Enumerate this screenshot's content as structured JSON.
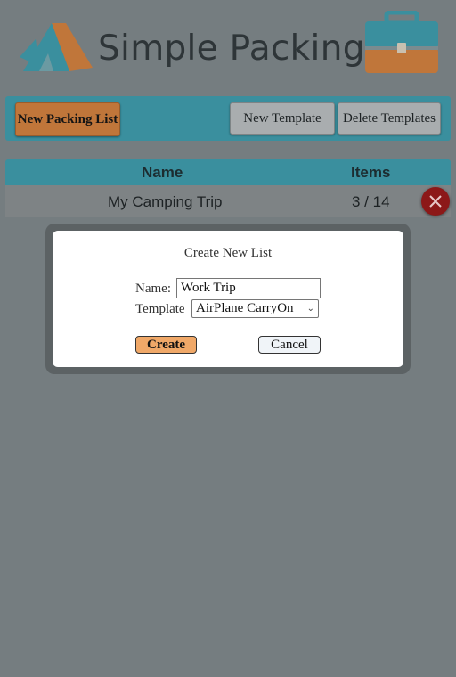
{
  "header": {
    "brand_text": "Simple Packing",
    "logo_icon": "tent-icon",
    "case_icon": "suitcase-icon"
  },
  "toolbar": {
    "new_packing_list_label": "New Packing List",
    "new_template_label": "New Template",
    "delete_templates_label": "Delete Templates"
  },
  "table": {
    "columns": [
      "Name",
      "Items"
    ],
    "rows": [
      {
        "name": "My Camping Trip",
        "items": "3 / 14"
      }
    ]
  },
  "modal": {
    "title": "Create New List",
    "name_label": "Name:",
    "name_value": "Work Trip",
    "template_label": "Template",
    "template_selected": "AirPlane CarryOn",
    "create_label": "Create",
    "cancel_label": "Cancel"
  },
  "colors": {
    "teal": "#3a8f9e",
    "orange": "#c0763a",
    "create_orange": "#f0a868",
    "delete_red": "#8c1818",
    "overlay": "#757d80"
  }
}
